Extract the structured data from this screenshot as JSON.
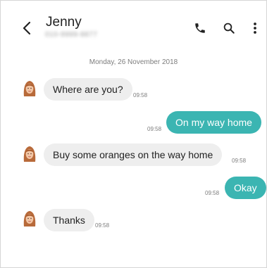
{
  "header": {
    "contact_name": "Jenny",
    "contact_number": "010-9999-8877"
  },
  "thread": {
    "date": "Monday, 26 November 2018",
    "messages": [
      {
        "direction": "incoming",
        "text": "Where are you?",
        "time": "09:58"
      },
      {
        "direction": "outgoing",
        "text": "On my way home",
        "time": "09:58"
      },
      {
        "direction": "incoming",
        "text": "Buy some oranges on the way home",
        "time": "09:58"
      },
      {
        "direction": "outgoing",
        "text": "Okay",
        "time": "09:58"
      },
      {
        "direction": "incoming",
        "text": "Thanks",
        "time": "09:58"
      }
    ]
  },
  "icons": [
    "back-arrow-icon",
    "phone-icon",
    "search-icon",
    "more-vert-icon",
    "avatar-icon"
  ],
  "colors": {
    "outgoing_bubble": "#3bb5b2",
    "incoming_bubble": "#eeeeee",
    "background": "#ffffff"
  }
}
